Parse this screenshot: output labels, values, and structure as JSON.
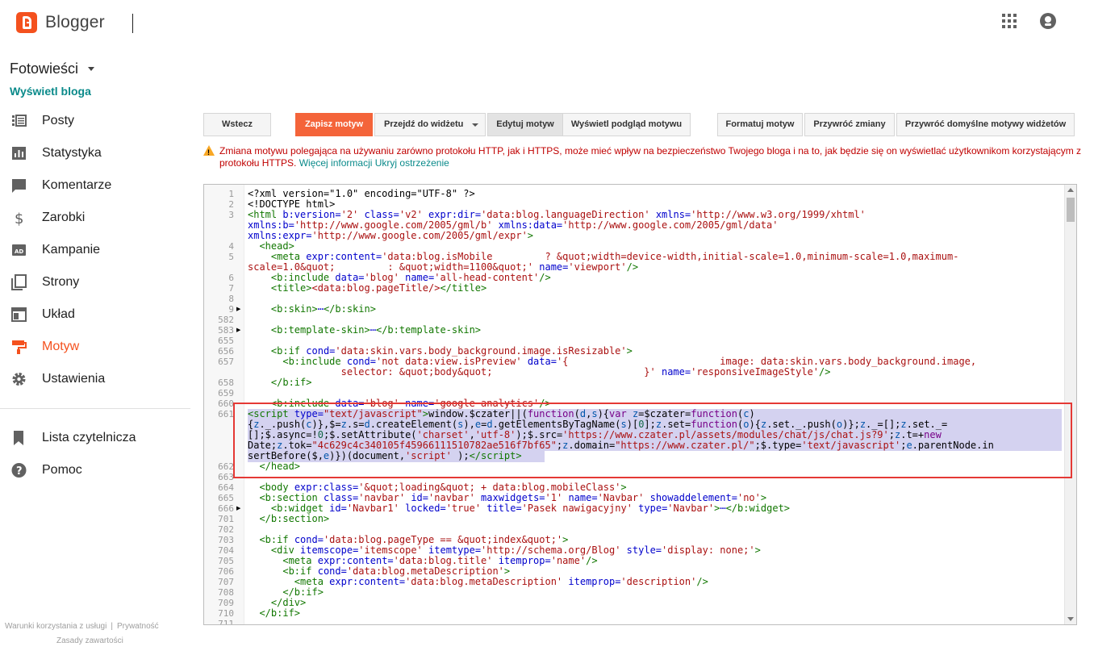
{
  "header": {
    "app_name": "Blogger"
  },
  "sidebar": {
    "blog_name": "Fotowieści",
    "view_blog": "Wyświetl bloga",
    "items": [
      {
        "label": "Posty",
        "icon": "posts-icon"
      },
      {
        "label": "Statystyka",
        "icon": "stats-icon"
      },
      {
        "label": "Komentarze",
        "icon": "comments-icon"
      },
      {
        "label": "Zarobki",
        "icon": "dollar-icon"
      },
      {
        "label": "Kampanie",
        "icon": "ad-icon"
      },
      {
        "label": "Strony",
        "icon": "pages-icon"
      },
      {
        "label": "Układ",
        "icon": "layout-icon"
      },
      {
        "label": "Motyw",
        "icon": "paint-roller-icon",
        "active": true
      },
      {
        "label": "Ustawienia",
        "icon": "gear-icon"
      }
    ],
    "secondary": [
      {
        "label": "Lista czytelnicza",
        "icon": "bookmark-icon"
      },
      {
        "label": "Pomoc",
        "icon": "help-icon"
      }
    ],
    "footer": {
      "terms": "Warunki korzystania z usługi",
      "privacy": "Prywatność",
      "content_policy": "Zasady zawartości"
    }
  },
  "toolbar": {
    "back": "Wstecz",
    "save": "Zapisz motyw",
    "go_to_widget": "Przejdź do widżetu",
    "edit_theme": "Edytuj motyw",
    "preview": "Wyświetl podgląd motywu",
    "format": "Formatuj motyw",
    "revert": "Przywróć zmiany",
    "restore_default": "Przywróć domyślne motywy widżetów"
  },
  "warning": {
    "text": "Zmiana motywu polegająca na używaniu zarówno protokołu HTTP, jak i HTTPS, może mieć wpływ na bezpieczeństwo Twojego bloga i na to, jak będzie się on wyświetlać użytkownikom korzystającym z protokołu HTTPS.",
    "more_info": "Więcej informacji",
    "hide": "Ukryj ostrzeżenie"
  },
  "editor": {
    "line_numbers": [
      "1",
      "2",
      "3",
      "",
      "",
      "4",
      "5",
      "",
      "6",
      "7",
      "8",
      "9",
      "582",
      "583",
      "655",
      "656",
      "657",
      "",
      "658",
      "659",
      "660",
      "661",
      "",
      "",
      "",
      "",
      "662",
      "663",
      "664",
      "665",
      "666",
      "701",
      "702",
      "703",
      "704",
      "705",
      "706",
      "707",
      "708",
      "709",
      "710",
      "711"
    ],
    "folded_lines": [
      "9",
      "583",
      "666"
    ]
  },
  "colors": {
    "accent": "#f4511e",
    "link": "#0a8a8a",
    "warning": "#c00000",
    "highlight_box": "#e53935"
  }
}
